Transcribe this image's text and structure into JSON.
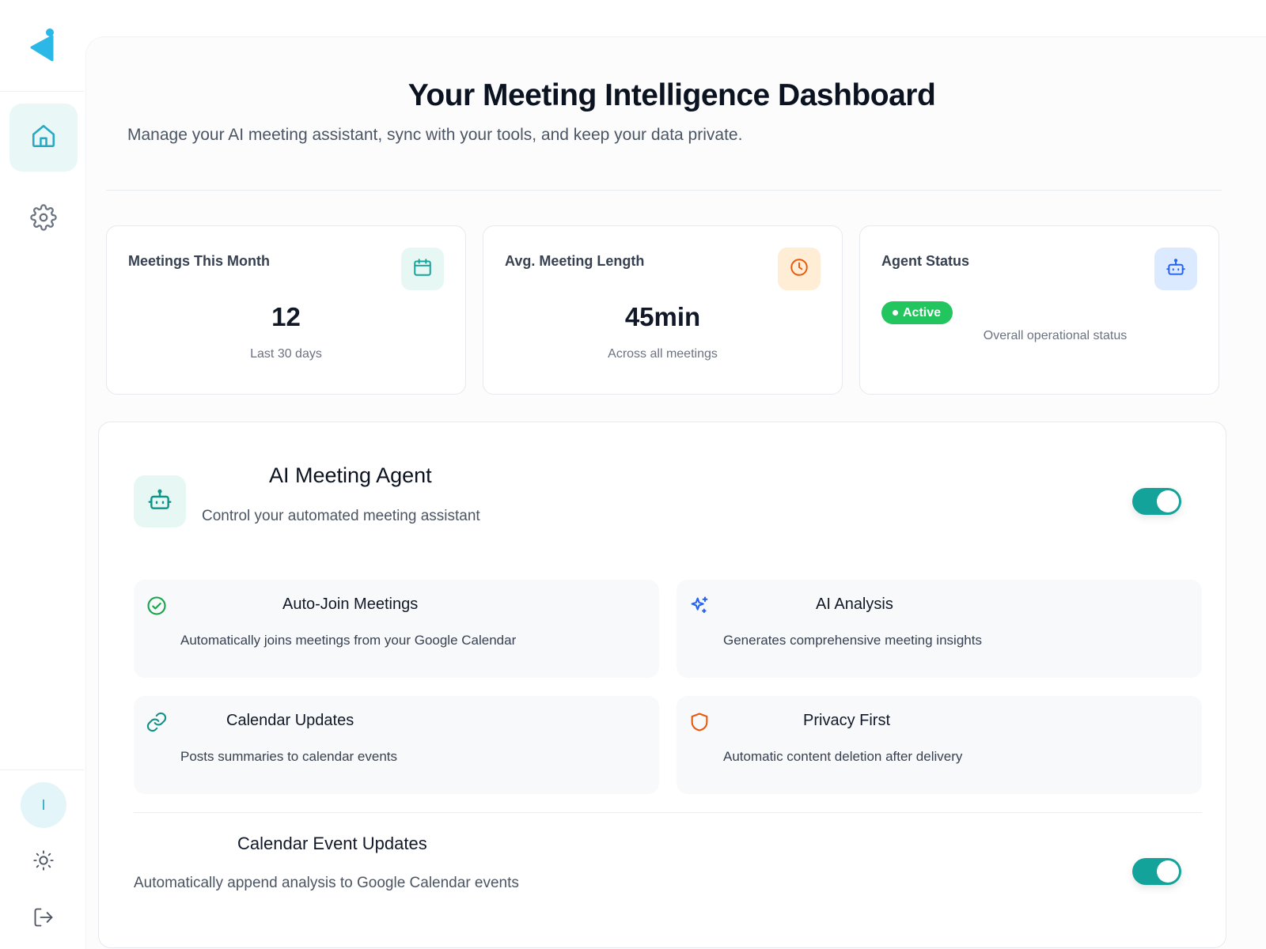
{
  "sidebar": {
    "logo_icon": "brand-logo",
    "nav": [
      {
        "icon": "home-icon",
        "active": true
      },
      {
        "icon": "gear-icon",
        "active": false
      }
    ],
    "avatar_initial": "I",
    "theme_icon": "sun-icon",
    "logout_icon": "logout-icon"
  },
  "header": {
    "title": "Your Meeting Intelligence Dashboard",
    "subtitle": "Manage your AI meeting assistant, sync with your tools, and keep your data private."
  },
  "stats": [
    {
      "label": "Meetings This Month",
      "value": "12",
      "note": "Last 30 days",
      "icon": "calendar-icon",
      "accent": "#14a39a",
      "icon_bg": "#e6f7f4"
    },
    {
      "label": "Avg. Meeting Length",
      "value": "45min",
      "note": "Across all meetings",
      "icon": "clock-icon",
      "accent": "#ea580c",
      "icon_bg": "#ffedd5"
    },
    {
      "label": "Agent Status",
      "badge": "Active",
      "note": "Overall operational status",
      "icon": "bot-icon",
      "accent": "#2563eb",
      "icon_bg": "#dbeafe"
    }
  ],
  "agent": {
    "title": "AI Meeting Agent",
    "subtitle": "Control your automated meeting assistant",
    "enabled": true,
    "features": [
      {
        "title": "Auto-Join Meetings",
        "desc": "Automatically joins meetings from your Google Calendar",
        "icon": "check-circle-icon",
        "color": "#16a34a"
      },
      {
        "title": "AI Analysis",
        "desc": "Generates comprehensive meeting insights",
        "icon": "sparkles-icon",
        "color": "#2563eb"
      },
      {
        "title": "Calendar Updates",
        "desc": "Posts summaries to calendar events",
        "icon": "link-icon",
        "color": "#0d9488"
      },
      {
        "title": "Privacy First",
        "desc": "Automatic content deletion after delivery",
        "icon": "shield-icon",
        "color": "#ea580c"
      }
    ],
    "calendar_updates": {
      "title": "Calendar Event Updates",
      "desc": "Automatically append analysis to Google Calendar events",
      "enabled": true
    }
  },
  "colors": {
    "accent": "#14a39a",
    "status_active": "#22c55e"
  }
}
